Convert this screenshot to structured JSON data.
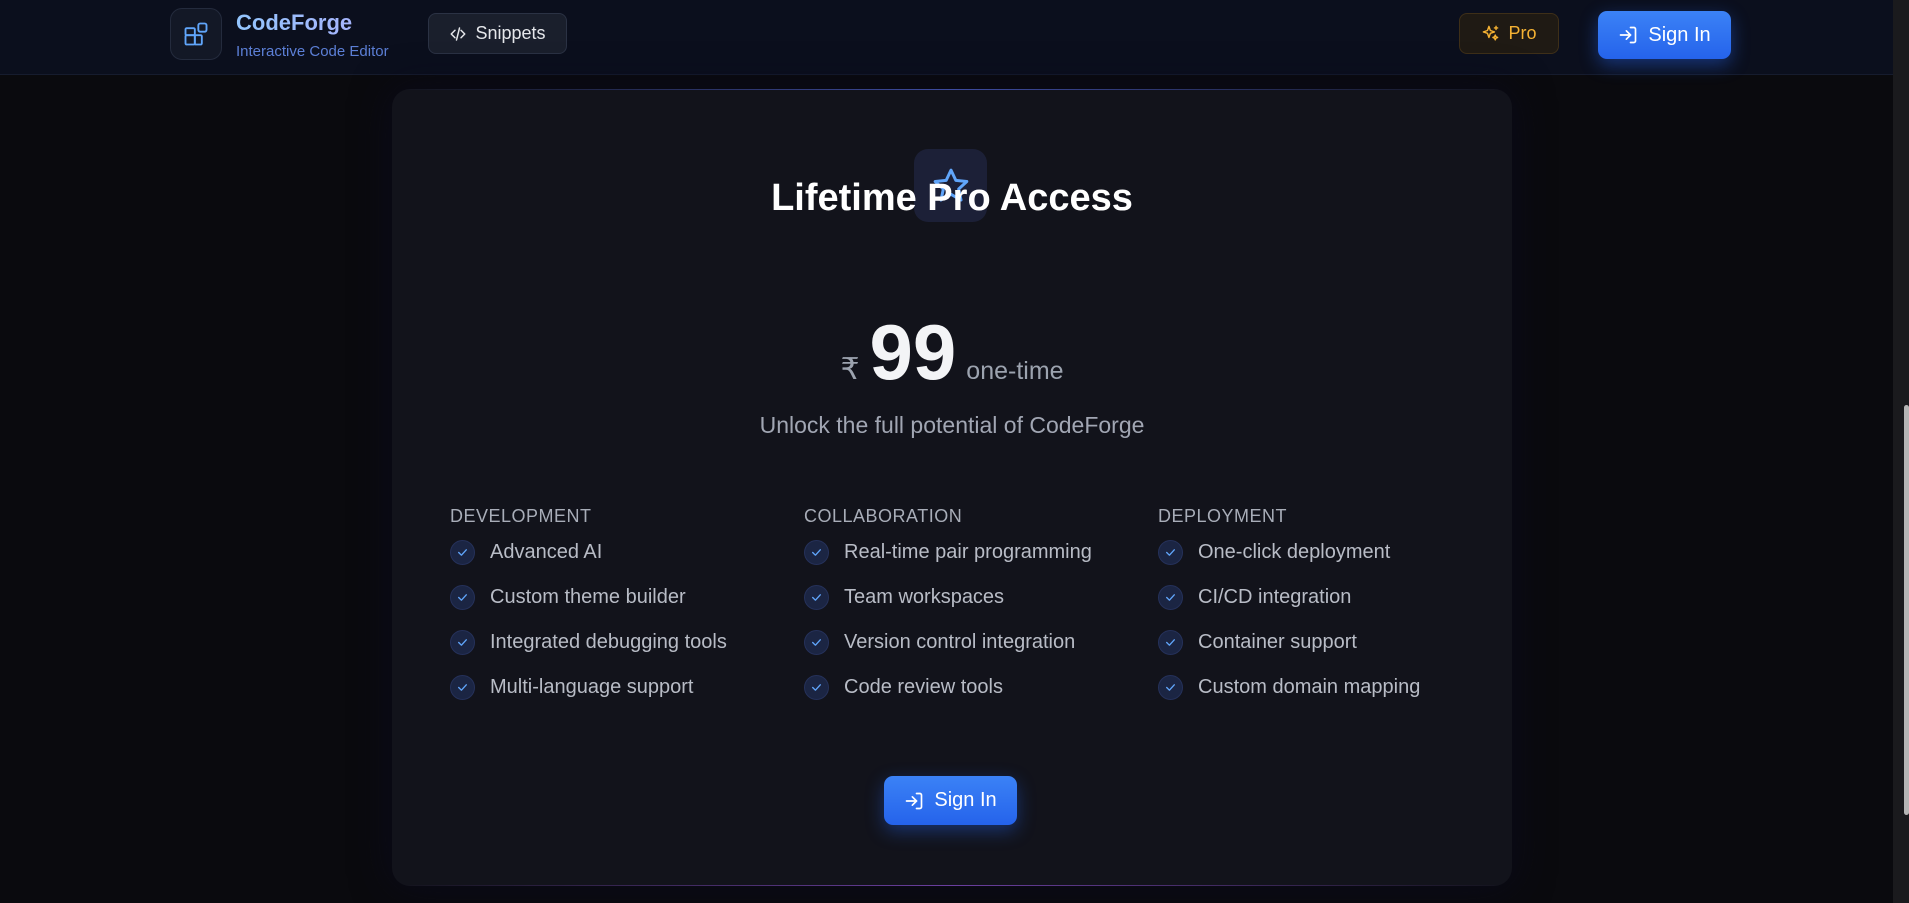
{
  "header": {
    "brand_title": "CodeForge",
    "brand_subtitle": "Interactive Code Editor",
    "snippets_label": "Snippets",
    "pro_label": "Pro",
    "signin_label": "Sign In"
  },
  "pricing": {
    "title": "Lifetime Pro Access",
    "currency": "₹",
    "price": "99",
    "period": "one-time",
    "tagline": "Unlock the full potential of CodeForge",
    "signin_label": "Sign In",
    "columns": [
      {
        "heading": "DEVELOPMENT",
        "features": [
          "Advanced AI",
          "Custom theme builder",
          "Integrated debugging tools",
          "Multi-language support"
        ]
      },
      {
        "heading": "COLLABORATION",
        "features": [
          "Real-time pair programming",
          "Team workspaces",
          "Version control integration",
          "Code review tools"
        ]
      },
      {
        "heading": "DEPLOYMENT",
        "features": [
          "One-click deployment",
          "CI/CD integration",
          "Container support",
          "Custom domain mapping"
        ]
      }
    ]
  },
  "colors": {
    "accent": "#3b82f6",
    "pro": "#f5b233",
    "background": "#0a0a0e",
    "card": "#12131b"
  },
  "icons": [
    "blocks-logo-icon",
    "code-icon",
    "sparkles-icon",
    "sign-in-icon",
    "star-icon",
    "check-icon"
  ]
}
